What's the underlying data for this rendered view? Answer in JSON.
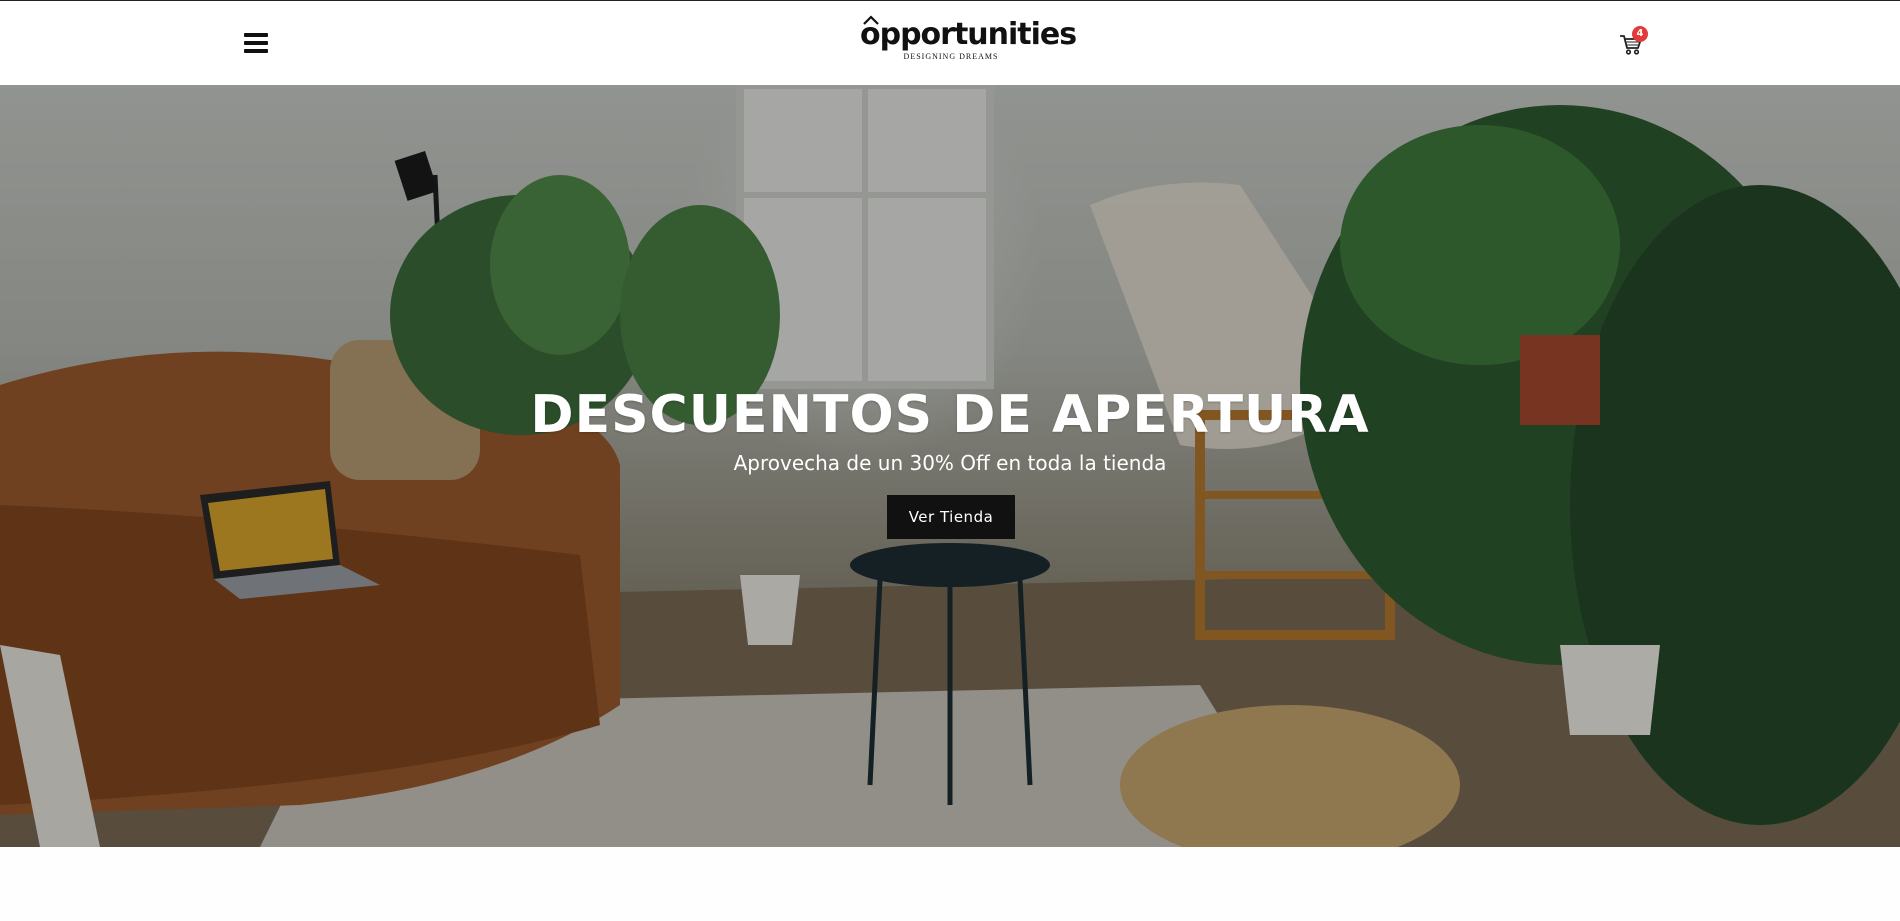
{
  "header": {
    "logo_text": "opportunities",
    "logo_tagline": "DESIGNING DREAMS",
    "cart_count": "4",
    "menu_icon": "hamburger-icon",
    "cart_icon": "shopping-cart-icon"
  },
  "hero": {
    "title": "DESCUENTOS DE APERTURA",
    "subtitle": "Aprovecha de un 30% Off en toda la tienda",
    "button_label": "Ver Tienda"
  },
  "colors": {
    "header_bg": "#ffffff",
    "button_bg": "#111111",
    "badge_bg": "#e33b3b"
  }
}
